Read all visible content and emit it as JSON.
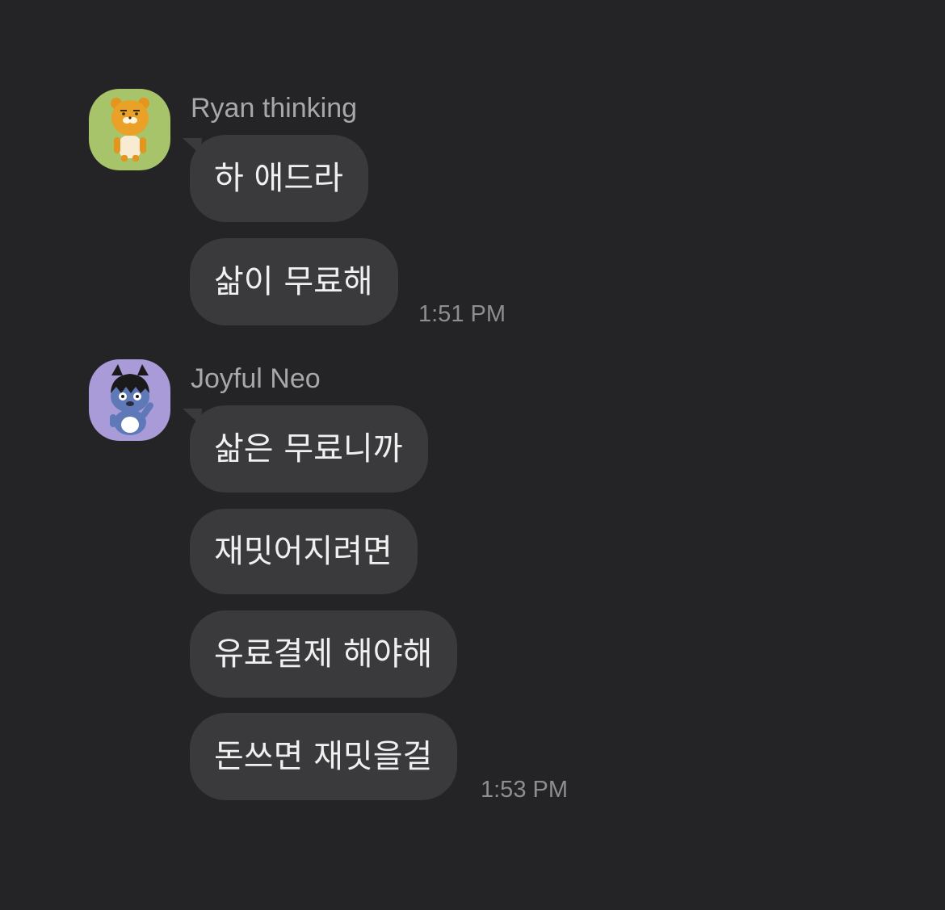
{
  "conversation": {
    "groups": [
      {
        "sender": "Ryan thinking",
        "avatar": "ryan-character-icon",
        "avatar_bg": "#a8c46a",
        "messages": [
          "하 애드라",
          "삶이 무료해"
        ],
        "time": "1:51 PM"
      },
      {
        "sender": "Joyful Neo",
        "avatar": "neo-character-icon",
        "avatar_bg": "#a99bd8",
        "messages": [
          "삶은 무료니까",
          "재밋어지려면",
          "유료결제 해야해",
          "돈쓰면 재밋을걸"
        ],
        "time": "1:53 PM"
      }
    ]
  },
  "colors": {
    "background": "#242426",
    "bubble": "#3a3a3c",
    "message_text": "#f0f0f0",
    "sender_text": "#a8a8aa",
    "time_text": "#8e8e90"
  }
}
